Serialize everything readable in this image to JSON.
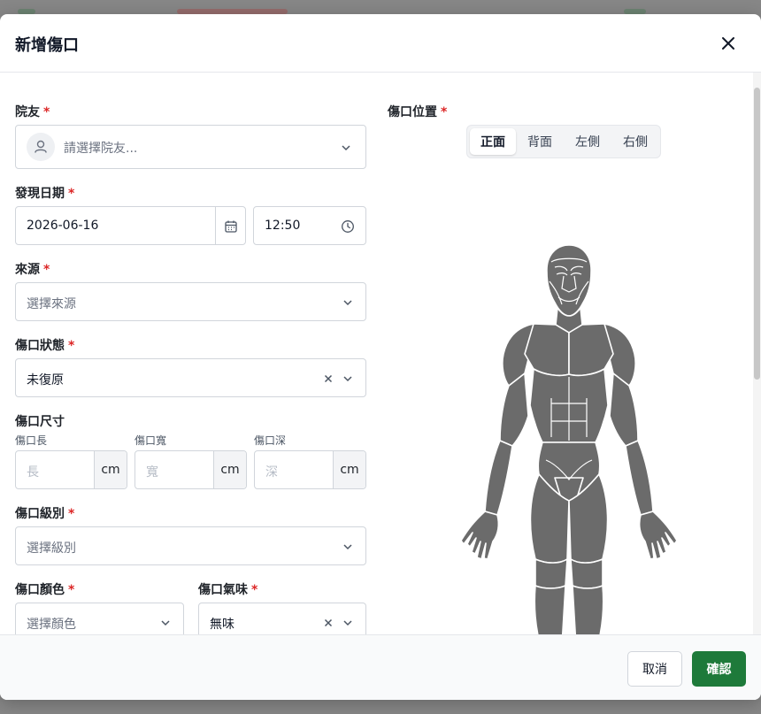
{
  "modal": {
    "title": "新增傷口"
  },
  "resident": {
    "label": "院友",
    "required": "*",
    "placeholder": "請選擇院友..."
  },
  "found_date": {
    "label": "發現日期",
    "required": "*",
    "date": "2026-06-16",
    "time": "12:50"
  },
  "source": {
    "label": "來源",
    "required": "*",
    "placeholder": "選擇來源"
  },
  "wound_status": {
    "label": "傷口狀態",
    "required": "*",
    "value": "未復原"
  },
  "wound_size": {
    "label": "傷口尺寸",
    "unit": "cm",
    "length": {
      "label": "傷口長",
      "placeholder": "長"
    },
    "width": {
      "label": "傷口寬",
      "placeholder": "寬"
    },
    "depth": {
      "label": "傷口深",
      "placeholder": "深"
    }
  },
  "wound_grade": {
    "label": "傷口級別",
    "required": "*",
    "placeholder": "選擇級別"
  },
  "wound_color": {
    "label": "傷口顏色",
    "required": "*",
    "placeholder": "選擇顏色"
  },
  "wound_odor": {
    "label": "傷口氣味",
    "required": "*",
    "value": "無味"
  },
  "wound_position": {
    "label": "傷口位置",
    "required": "*",
    "views": [
      "正面",
      "背面",
      "左側",
      "右側"
    ],
    "selected_view": "正面"
  },
  "footer": {
    "cancel_label": "取消",
    "confirm_label": "確認"
  },
  "colors": {
    "accent": "#1e7a3a",
    "required": "#dc2626",
    "figure": "#6b6b6b"
  },
  "icons": [
    "close-icon",
    "user-icon",
    "chevron-down-icon",
    "calendar-icon",
    "clock-icon",
    "clear-icon"
  ]
}
